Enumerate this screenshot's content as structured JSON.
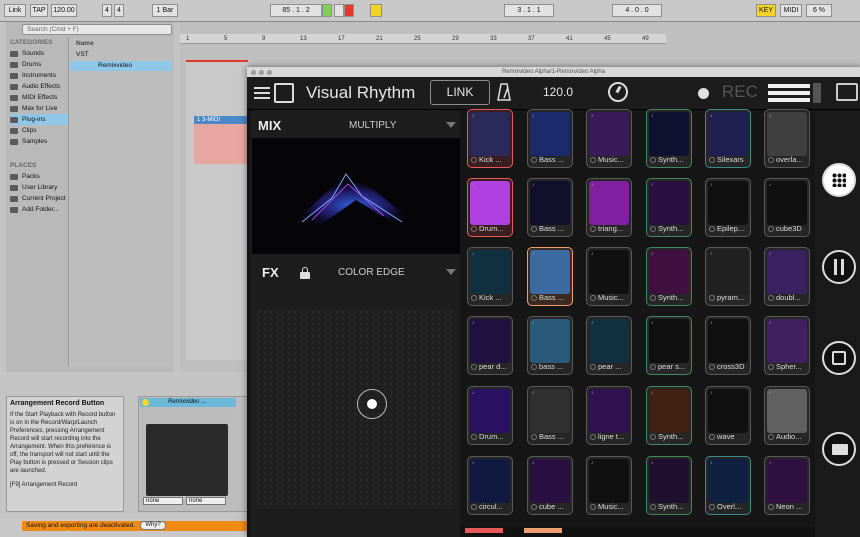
{
  "topbar": {
    "link": "Link",
    "tap": "TAP",
    "tempo": "120.00",
    "sig_num": "4",
    "sig_den": "4",
    "quant": "1 Bar",
    "position": "85 . 1 . 2",
    "loop_start": "3 . 1 . 1",
    "loop_len": "4 . 0 . 0",
    "key": "KEY",
    "midi": "MIDI",
    "cpu": "6 %"
  },
  "browser": {
    "search_placeholder": "Search (Cmd + F)",
    "categories_header": "CATEGORIES",
    "categories": [
      "Sounds",
      "Drums",
      "Instruments",
      "Audio Effects",
      "MIDI Effects",
      "Max for Live",
      "Plug-ins",
      "Clips",
      "Samples"
    ],
    "selected_category": "Plug-ins",
    "places_header": "PLACES",
    "places": [
      "Packs",
      "User Library",
      "Current Project",
      "Add Folder..."
    ],
    "name_header": "Name",
    "items": [
      "VST",
      "Remixvideo"
    ]
  },
  "arrangement": {
    "ruler": [
      "1",
      "5",
      "9",
      "13",
      "17",
      "21",
      "25",
      "29",
      "33",
      "37",
      "41",
      "45",
      "49"
    ],
    "track_name": "1 3-MIDI"
  },
  "info": {
    "title": "Arrangement Record Button",
    "body": "If the Start Playback with Record button is on in the Record/Warp/Launch Preferences, pressing Arrangement Record will start recording into the Arrangement. When this preference is off, the transport will not start until the Play button is pressed or Session clips are launched.",
    "shortcut": "[F9] Arrangement Record"
  },
  "device": {
    "name": "Remixvideo ...",
    "select_a": "none",
    "select_b": "none"
  },
  "status": {
    "warning": "Saving and exporting are deactivated.",
    "why": "Why?"
  },
  "plugin": {
    "window_title": "Remixvideo Alpha/1-Remixvideo Alpha",
    "app_name": "Visual Rhythm",
    "link_label": "LINK",
    "bpm": "120.0",
    "rec_label": "REC",
    "mix_label": "MIX",
    "mix_mode": "MULTIPLY",
    "fx_label": "FX",
    "fx_mode": "COLOR EDGE"
  },
  "tiles": [
    [
      "Kick ...",
      "Bass ...",
      "Music...",
      "Synth...",
      "Silexars",
      "overla..."
    ],
    [
      "Drum...",
      "Bass ...",
      "triang...",
      "Synth...",
      "Epilep...",
      "cube3D"
    ],
    [
      "Kick ...",
      "Bass ...",
      "Music...",
      "Synth...",
      "pyram...",
      "doubl..."
    ],
    [
      "pear d...",
      "bass ...",
      "pear ...",
      "pear s...",
      "cross3D",
      "Spher..."
    ],
    [
      "Drum...",
      "Bass ...",
      "ligne t...",
      "Synth...",
      "wave",
      "Audio..."
    ],
    [
      "circul...",
      "cube ...",
      "Music...",
      "Synth...",
      "Overl...",
      "Neon ..."
    ]
  ],
  "tile_styles": [
    [
      "red",
      "grey",
      "grey",
      "green",
      "teal",
      "grey"
    ],
    [
      "red",
      "grey",
      "grey",
      "green",
      "grey",
      "grey"
    ],
    [
      "grey",
      "orange",
      "grey",
      "green",
      "grey",
      "grey"
    ],
    [
      "grey",
      "grey",
      "grey",
      "green",
      "grey",
      "grey"
    ],
    [
      "grey",
      "grey",
      "grey",
      "green",
      "grey",
      "grey"
    ],
    [
      "grey",
      "grey",
      "grey",
      "green",
      "teal",
      "grey"
    ]
  ],
  "colors": {
    "accent_red": "#e85a5a",
    "accent_orange": "#f0a070",
    "accent_green": "#3f8a5a",
    "browser_select": "#8ec7e8",
    "warning": "#ef8a14"
  },
  "sidebar_icons": [
    "grid-icon",
    "sliders-icon",
    "edit-icon",
    "folder-icon"
  ]
}
